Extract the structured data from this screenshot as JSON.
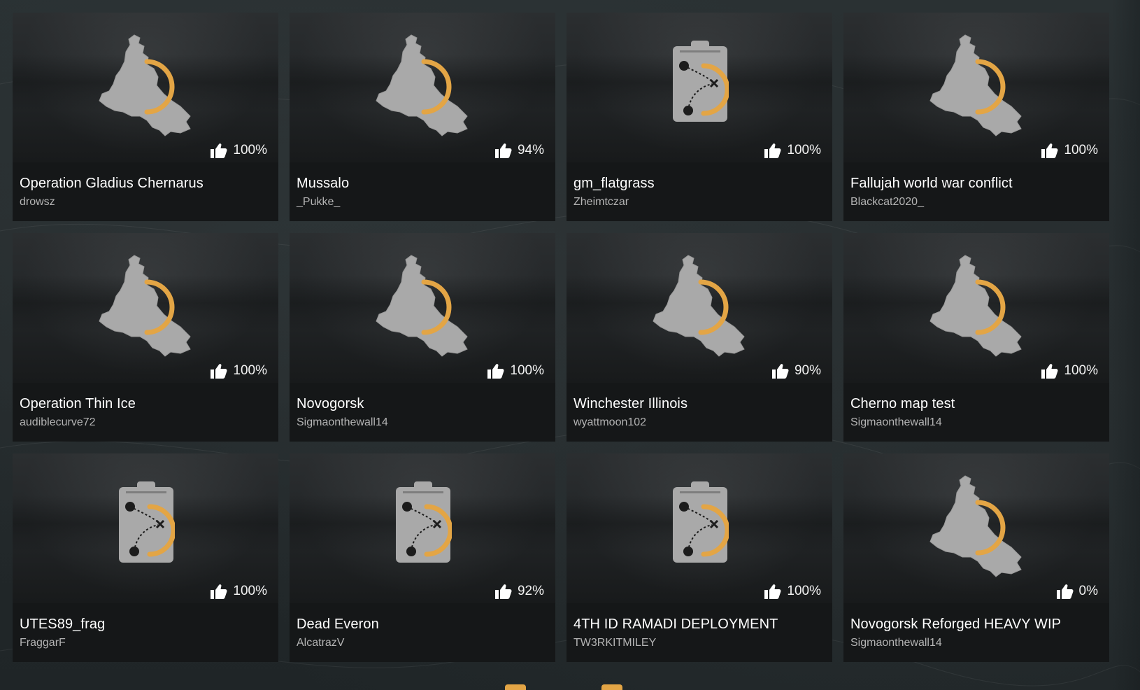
{
  "colors": {
    "accent": "#e3a545",
    "card_bg": "#151718",
    "title_text": "#ffffff",
    "author_text": "#b4b4b4"
  },
  "cards": [
    {
      "title": "Operation Gladius Chernarus",
      "author": "drowsz",
      "rating": "100%",
      "icon": "map-region-icon"
    },
    {
      "title": "Mussalo",
      "author": "_Pukke_",
      "rating": "94%",
      "icon": "map-region-icon"
    },
    {
      "title": "gm_flatgrass",
      "author": "Zheimtczar",
      "rating": "100%",
      "icon": "clipboard-plan-icon"
    },
    {
      "title": "Fallujah world war conflict",
      "author": "Blackcat2020_",
      "rating": "100%",
      "icon": "map-region-icon"
    },
    {
      "title": "Operation Thin Ice",
      "author": "audiblecurve72",
      "rating": "100%",
      "icon": "map-region-icon"
    },
    {
      "title": "Novogorsk",
      "author": "Sigmaonthewall14",
      "rating": "100%",
      "icon": "map-region-icon"
    },
    {
      "title": "Winchester Illinois",
      "author": "wyattmoon102",
      "rating": "90%",
      "icon": "map-region-icon"
    },
    {
      "title": "Cherno map test",
      "author": "Sigmaonthewall14",
      "rating": "100%",
      "icon": "map-region-icon"
    },
    {
      "title": "UTES89_frag",
      "author": "FraggarF",
      "rating": "100%",
      "icon": "clipboard-plan-icon"
    },
    {
      "title": "Dead Everon",
      "author": "AlcatrazV",
      "rating": "92%",
      "icon": "clipboard-plan-icon"
    },
    {
      "title": "4TH ID RAMADI DEPLOYMENT",
      "author": "TW3RKITMILEY",
      "rating": "100%",
      "icon": "clipboard-plan-icon"
    },
    {
      "title": "Novogorsk Reforged HEAVY WIP",
      "author": "Sigmaonthewall14",
      "rating": "0%",
      "icon": "map-region-icon"
    }
  ]
}
